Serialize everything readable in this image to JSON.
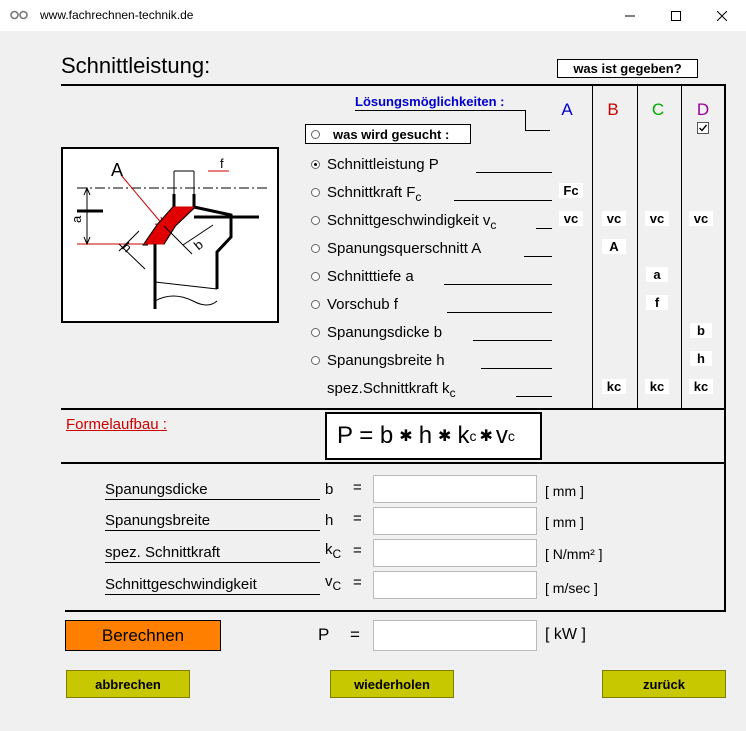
{
  "window": {
    "title": "www.fachrechnen-technik.de"
  },
  "main": {
    "title": "Schnittleistung:",
    "given_button": "was ist gegeben?",
    "solutions_label": "Lösungsmöglichkeiten :",
    "sought_label": "was  wird  gesucht :",
    "columns": [
      {
        "label": "A",
        "color": "#0000cc"
      },
      {
        "label": "B",
        "color": "#cc0000"
      },
      {
        "label": "C",
        "color": "#00aa00"
      },
      {
        "label": "D",
        "color": "#990099"
      }
    ],
    "diagram": {
      "labels": {
        "A": "A",
        "f": "f",
        "a": "a",
        "h": "h",
        "b": "b"
      }
    },
    "options": [
      {
        "name": "Schnittleistung  P",
        "sub": "",
        "selected": true
      },
      {
        "name": "Schnittkraft  F",
        "sub": "c",
        "selected": false
      },
      {
        "name": "Schnittgeschwindigkeit  v",
        "sub": "c",
        "selected": false
      },
      {
        "name": "Spanungsquerschnitt  A",
        "sub": "",
        "selected": false
      },
      {
        "name": "Schnitttiefe  a",
        "sub": "",
        "selected": false
      },
      {
        "name": "Vorschub  f",
        "sub": "",
        "selected": false
      },
      {
        "name": "Spanungsdicke  b",
        "sub": "",
        "selected": false
      },
      {
        "name": "Spanungsbreite  h",
        "sub": "",
        "selected": false
      },
      {
        "name": "spez.Schnittkraft  k",
        "sub": "c",
        "selected": false
      }
    ],
    "chips": {
      "fc": "Fc",
      "vc": "vc",
      "A": "A",
      "a": "a",
      "f": "f",
      "b": "b",
      "h": "h",
      "kc": "kc"
    },
    "formula_title": "Formelaufbau :",
    "formula": {
      "p": "P = b",
      "h": "h",
      "k": "k",
      "c": "c",
      "v": "v",
      "c2": "c"
    },
    "inputs": [
      {
        "label": "Spanungsdicke",
        "symbol": "b",
        "sub": "",
        "unit": "[ mm ]",
        "value": ""
      },
      {
        "label": "Spanungsbreite",
        "symbol": "h",
        "sub": "",
        "unit": "[ mm ]",
        "value": ""
      },
      {
        "label": "spez. Schnittkraft",
        "symbol": "k",
        "sub": "C",
        "unit": "[ N/mm² ]",
        "value": ""
      },
      {
        "label": "Schnittgeschwindigkeit",
        "symbol": "v",
        "sub": "C",
        "unit": "[ m/sec ]",
        "value": ""
      }
    ],
    "equals": "=",
    "calc_button": "Berechnen",
    "result": {
      "symbol": "P",
      "unit": "[ kW ]",
      "value": ""
    },
    "buttons": {
      "cancel": "abbrechen",
      "repeat": "wiederholen",
      "back": "zurück"
    }
  }
}
